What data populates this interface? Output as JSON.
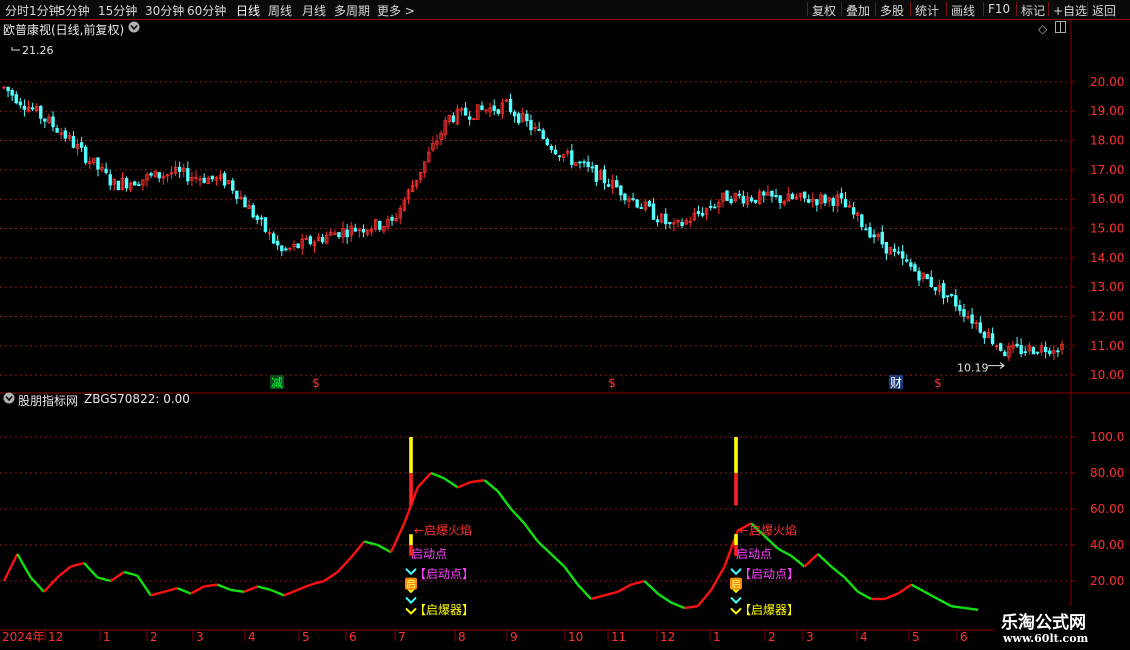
{
  "toolbar": {
    "periods": [
      "分时",
      "1分钟",
      "5分钟",
      "15分钟",
      "30分钟",
      "60分钟",
      "日线",
      "周线",
      "月线",
      "多周期",
      "更多"
    ],
    "active_period": "日线",
    "more_arrow": ">",
    "actions": [
      "复权",
      "叠加",
      "多股",
      "统计",
      "画线",
      "F10",
      "标记",
      "+自选",
      "返回"
    ]
  },
  "main_panel": {
    "title": "欧普康视(日线,前复权)",
    "high_label": "21.26",
    "low_label": "10.19",
    "y_ticks": [
      "20.00",
      "19.00",
      "18.00",
      "17.00",
      "16.00",
      "15.00",
      "14.00",
      "13.00",
      "12.00",
      "11.00",
      "10.00"
    ],
    "event_markers": [
      {
        "text": "减",
        "color": "#00ff40",
        "bg": "#0a4a1a"
      },
      {
        "text": "$",
        "color": "#ff3030"
      },
      {
        "text": "$",
        "color": "#ff3030"
      },
      {
        "text": "财",
        "color": "#ffffff",
        "bg": "#1a3a7a"
      },
      {
        "text": "$",
        "color": "#ff3030"
      }
    ]
  },
  "indicator_panel": {
    "title": "股朋指标网",
    "code_label": "ZBGS70822: 0.00",
    "y_ticks": [
      "100.0",
      "80.00",
      "60.00",
      "40.00",
      "20.00"
    ],
    "signals": [
      {
        "flame": "←启爆火焰",
        "start": "启动点",
        "start_bracket": "【启动点】",
        "fire": "启",
        "trigger": "【启爆器】"
      },
      {
        "flame": "←启爆火焰",
        "start": "启动点",
        "start_bracket": "【启动点】",
        "fire": "启",
        "trigger": "【启爆器】"
      }
    ]
  },
  "x_axis": {
    "labels": [
      "2024年",
      "12",
      "1",
      "2",
      "3",
      "4",
      "5",
      "6",
      "7",
      "8",
      "9",
      "10",
      "11",
      "12",
      "1",
      "2",
      "3",
      "4",
      "5",
      "6"
    ]
  },
  "watermark": {
    "title": "乐淘公式网",
    "url": "www.60lt.com"
  },
  "colors": {
    "up": "#ff3030",
    "down": "#54ffff",
    "line_up": "#ff1010",
    "line_down": "#10e010",
    "grid": "#8b1a1a",
    "axis_text": "#ff3030",
    "yellow": "#ffff00",
    "magenta": "#ff40ff"
  },
  "chart_data": {
    "type": "candlestick",
    "title": "欧普康视(日线,前复权)",
    "ylim": [
      9.8,
      21.6
    ],
    "price_high": 21.26,
    "price_low": 10.19,
    "close_path_by_month": [
      {
        "month": "2024-11",
        "close": 19.8
      },
      {
        "month": "2024-12",
        "close": 18.3
      },
      {
        "month": "2025-01",
        "close": 16.5
      },
      {
        "month": "2025-02",
        "close": 16.9
      },
      {
        "month": "2025-03",
        "close": 16.6
      },
      {
        "month": "2025-04",
        "close": 14.2
      },
      {
        "month": "2025-05",
        "close": 14.9
      },
      {
        "month": "2025-06",
        "close": 15.2
      },
      {
        "month": "2025-07",
        "close": 18.8
      },
      {
        "month": "2025-08",
        "close": 19.2
      },
      {
        "month": "2025-09",
        "close": 17.6
      },
      {
        "month": "2025-10",
        "close": 16.4
      },
      {
        "month": "2025-11",
        "close": 15.0
      },
      {
        "month": "2025-12",
        "close": 16.1
      },
      {
        "month": "2026-01",
        "close": 16.0
      },
      {
        "month": "2026-02",
        "close": 16.0
      },
      {
        "month": "2026-03",
        "close": 14.1
      },
      {
        "month": "2026-04",
        "close": 12.6
      },
      {
        "month": "2026-05",
        "close": 10.8
      },
      {
        "month": "2026-06",
        "close": 11.0
      }
    ],
    "indicator": {
      "name": "ZBGS70822",
      "ylim": [
        0,
        105
      ],
      "series": [
        20,
        35,
        22,
        14,
        22,
        28,
        30,
        22,
        20,
        25,
        23,
        12,
        14,
        16,
        13,
        17,
        18,
        15,
        14,
        17,
        15,
        12,
        15,
        18,
        20,
        25,
        33,
        42,
        40,
        36,
        52,
        72,
        80,
        77,
        72,
        75,
        76,
        70,
        60,
        52,
        42,
        35,
        28,
        18,
        10,
        12,
        14,
        18,
        20,
        13,
        8,
        5,
        6,
        15,
        28,
        48,
        52,
        45,
        38,
        34,
        28,
        35,
        28,
        22,
        14,
        10,
        10,
        13,
        18,
        14,
        10,
        6,
        5,
        4
      ]
    }
  }
}
